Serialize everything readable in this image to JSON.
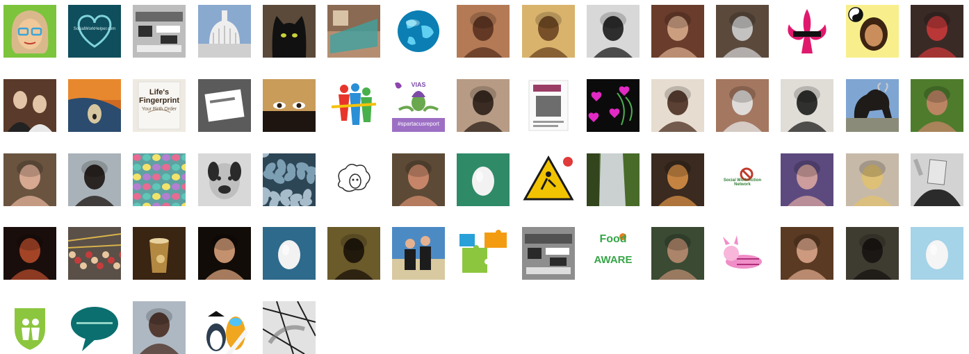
{
  "page": {
    "background": "#ffffff"
  },
  "avatars": [
    {
      "name": "avatar-cartoon-woman-glasses",
      "icon": "cartoon-glasses-woman",
      "bg": "#7cc43c",
      "fg": "#f0c89a"
    },
    {
      "name": "avatar-socialworkhelper-heart",
      "icon": "heart-outline",
      "bg": "#0f4e5c",
      "fg": "#7fd3dc",
      "text": "SocialWorkHelper.com"
    },
    {
      "name": "avatar-pixel-grey",
      "icon": "pixelated",
      "bg": "#bdbdbd",
      "fg": "#2e2e2e"
    },
    {
      "name": "avatar-capitol-dome",
      "icon": "dome",
      "bg": "#8aa9cf",
      "fg": "#eeeeee"
    },
    {
      "name": "avatar-black-cat",
      "icon": "cat",
      "bg": "#5b4a3a",
      "fg": "#111111"
    },
    {
      "name": "avatar-photo-collage",
      "icon": "collage",
      "bg": "#b58e72",
      "fg": "#3fa3a0"
    },
    {
      "name": "avatar-globe",
      "icon": "globe",
      "bg": "#ffffff",
      "fg": "#0b7fb3"
    },
    {
      "name": "avatar-woman-portrait",
      "icon": "person",
      "bg": "#b47a55",
      "fg": "#5a3220"
    },
    {
      "name": "avatar-woman-sepia",
      "icon": "person",
      "bg": "#d9b36c",
      "fg": "#6b4421"
    },
    {
      "name": "avatar-man-black-white",
      "icon": "person",
      "bg": "#d8d8d8",
      "fg": "#1c1c1c"
    },
    {
      "name": "avatar-woman-sunglasses",
      "icon": "person",
      "bg": "#6a3c2c",
      "fg": "#d7a88a"
    },
    {
      "name": "avatar-woman-desk",
      "icon": "person",
      "bg": "#5b4a3c",
      "fg": "#cfcfcf"
    },
    {
      "name": "avatar-fleur-de-lis",
      "icon": "fleur-de-lis",
      "bg": "#ffffff",
      "fg": "#e0196d"
    },
    {
      "name": "avatar-yin-yang-woman",
      "icon": "yin-yang-person",
      "bg": "#f8ef8c",
      "fg": "#3d2412"
    },
    {
      "name": "avatar-woman-red",
      "icon": "person",
      "bg": "#3a2a26",
      "fg": "#c8383a"
    },
    {
      "name": "avatar-couple",
      "icon": "couple",
      "bg": "#5a3a2a",
      "fg": "#e2c4a6"
    },
    {
      "name": "avatar-the-scream",
      "icon": "scream",
      "bg": "#cf6a22",
      "fg": "#2b4c6e"
    },
    {
      "name": "avatar-book-cover",
      "icon": "book",
      "bg": "#efeae1",
      "fg": "#3a2a1a",
      "text": "Life's Fingerprint",
      "subtext": "Your Birth Order"
    },
    {
      "name": "avatar-hands-card",
      "icon": "card",
      "bg": "#7d7d7d",
      "fg": "#ffffff"
    },
    {
      "name": "avatar-eyes-veil",
      "icon": "eyes",
      "bg": "#c99c5a",
      "fg": "#2c1f14"
    },
    {
      "name": "avatar-colorful-figures",
      "icon": "figures",
      "bg": "#ffffff",
      "fg": "#2a8fd6"
    },
    {
      "name": "avatar-vias-thistle",
      "icon": "thistle",
      "bg": "#ffffff",
      "fg": "#7d4aa8",
      "text": "VIAS",
      "subtext": "#spartacusreport"
    },
    {
      "name": "avatar-woman-smiling",
      "icon": "person",
      "bg": "#b79b84",
      "fg": "#2c1f18"
    },
    {
      "name": "avatar-poster",
      "icon": "poster",
      "bg": "#ffffff",
      "fg": "#8a1c4a"
    },
    {
      "name": "avatar-pink-hearts",
      "icon": "hearts",
      "bg": "#0b0b0b",
      "fg": "#e12ac3"
    },
    {
      "name": "avatar-woman-curly",
      "icon": "person",
      "bg": "#e6dccf",
      "fg": "#4b2f22"
    },
    {
      "name": "avatar-selfie-sunglasses",
      "icon": "person",
      "bg": "#a47760",
      "fg": "#e6e6e6"
    },
    {
      "name": "avatar-woman-glasses-short-hair",
      "icon": "person",
      "bg": "#e0dcd6",
      "fg": "#1d1d1d"
    },
    {
      "name": "avatar-bison-statue",
      "icon": "bison",
      "bg": "#7fa6d2",
      "fg": "#1e1b19"
    },
    {
      "name": "avatar-woman-smile-green",
      "icon": "person",
      "bg": "#4e7c2c",
      "fg": "#c8866a"
    },
    {
      "name": "avatar-woman-older-glasses",
      "icon": "person",
      "bg": "#6a5440",
      "fg": "#e3b299"
    },
    {
      "name": "avatar-woman-dark-hair",
      "icon": "person",
      "bg": "#a9b2b8",
      "fg": "#1c1412"
    },
    {
      "name": "avatar-knitted-pattern",
      "icon": "knit",
      "bg": "#5fa1a1",
      "fg": "#e76b93"
    },
    {
      "name": "avatar-cartoon-dog",
      "icon": "dog",
      "bg": "#d8d8d8",
      "fg": "#2a2a2a"
    },
    {
      "name": "avatar-pebbles",
      "icon": "pebbles",
      "bg": "#2d4656",
      "fg": "#7d9fb3"
    },
    {
      "name": "avatar-sheep-drawing",
      "icon": "sheep",
      "bg": "#ffffff",
      "fg": "#2b2b2b"
    },
    {
      "name": "avatar-woman-selfie-smile",
      "icon": "person",
      "bg": "#5d4a36",
      "fg": "#d28c6e"
    },
    {
      "name": "avatar-default-egg-green",
      "icon": "egg",
      "bg": "#2f8a68",
      "fg": "#f2f2f2"
    },
    {
      "name": "avatar-warning-sign",
      "icon": "warning",
      "bg": "#ffffff",
      "fg": "#f2c300"
    },
    {
      "name": "avatar-waterfall",
      "icon": "waterfall",
      "bg": "#496b2a",
      "fg": "#d8dde2"
    },
    {
      "name": "avatar-woman-drink",
      "icon": "person",
      "bg": "#3a2a1f",
      "fg": "#d58d45"
    },
    {
      "name": "avatar-social-work-action-network",
      "icon": "network-logo",
      "bg": "#ffffff",
      "fg": "#2e7d32",
      "text": "Social Work Action Network"
    },
    {
      "name": "avatar-woman-purple",
      "icon": "person",
      "bg": "#5c4a7f",
      "fg": "#d8a6a0"
    },
    {
      "name": "avatar-woman-blonde",
      "icon": "person",
      "bg": "#c7b9a8",
      "fg": "#e0c170"
    },
    {
      "name": "avatar-paper-bag-head",
      "icon": "bag-head",
      "bg": "#d3d3d3",
      "fg": "#2b2b2b"
    },
    {
      "name": "avatar-woman-red-hair",
      "icon": "person",
      "bg": "#1a0e0c",
      "fg": "#b34a2a"
    },
    {
      "name": "avatar-party-crowd",
      "icon": "crowd",
      "bg": "#5a5048",
      "fg": "#c53c3c"
    },
    {
      "name": "avatar-drink-glass",
      "icon": "glass",
      "bg": "#3a2412",
      "fg": "#c99b4a"
    },
    {
      "name": "avatar-woman-laughing",
      "icon": "person",
      "bg": "#120c08",
      "fg": "#d8a07a"
    },
    {
      "name": "avatar-default-egg-blue",
      "icon": "egg",
      "bg": "#2e6a8c",
      "fg": "#f2f2f2"
    },
    {
      "name": "avatar-young-man",
      "icon": "person",
      "bg": "#6b5a2a",
      "fg": "#1a1208"
    },
    {
      "name": "avatar-family-beach",
      "icon": "family",
      "bg": "#4c8ac4",
      "fg": "#1c1c1c"
    },
    {
      "name": "avatar-puzzle-pieces",
      "icon": "puzzle",
      "bg": "#ffffff",
      "fg": "#2aa0d8"
    },
    {
      "name": "avatar-pixel-stadium",
      "icon": "pixelated",
      "bg": "#8e8e8e",
      "fg": "#2a2a2a"
    },
    {
      "name": "avatar-food-aware",
      "icon": "food-aware",
      "bg": "#ffffff",
      "fg": "#37a548",
      "text": "Food",
      "subtext": "AWARE"
    },
    {
      "name": "avatar-woman-garden",
      "icon": "person",
      "bg": "#3a4a33",
      "fg": "#b98b70"
    },
    {
      "name": "avatar-piglet",
      "icon": "piglet",
      "bg": "#ffffff",
      "fg": "#f08ec8"
    },
    {
      "name": "avatar-man-suit-books",
      "icon": "person",
      "bg": "#5a3a22",
      "fg": "#d9a58a"
    },
    {
      "name": "avatar-man-smiling",
      "icon": "person",
      "bg": "#3e3b30",
      "fg": "#171412"
    },
    {
      "name": "avatar-default-egg-light-blue",
      "icon": "egg",
      "bg": "#a5d3e8",
      "fg": "#f5f5f5"
    },
    {
      "name": "avatar-family-shield",
      "icon": "shield",
      "bg": "#ffffff",
      "fg": "#8cc63f"
    },
    {
      "name": "avatar-speech-bubble",
      "icon": "speech-bubble",
      "bg": "#ffffff",
      "fg": "#0b6f6f"
    },
    {
      "name": "avatar-woman-outdoors",
      "icon": "person",
      "bg": "#aeb8c2",
      "fg": "#4a2e22"
    },
    {
      "name": "avatar-graduation-penguin-duck",
      "icon": "penguin-duck",
      "bg": "#ffffff",
      "fg": "#f0a71f"
    },
    {
      "name": "avatar-sketch-black-white",
      "icon": "sketch",
      "bg": "#e2e2e2",
      "fg": "#1e1e1e"
    }
  ]
}
